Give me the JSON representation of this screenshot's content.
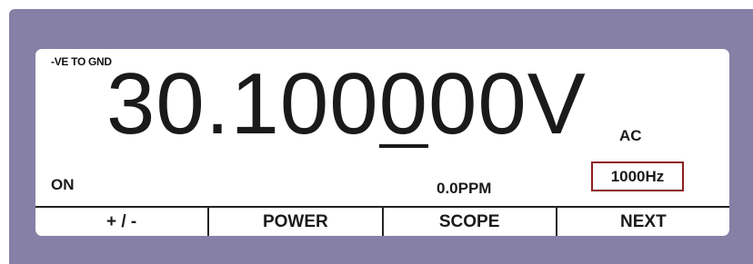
{
  "display": {
    "mode_label": "-VE TO GND",
    "reading_prefix": "30.100",
    "reading_cursor_digit": "0",
    "reading_suffix": "00V",
    "coupling": "AC",
    "output_state": "ON",
    "deviation": "0.0PPM",
    "frequency": "1000Hz"
  },
  "softkeys": [
    {
      "label": "+ / -"
    },
    {
      "label": "POWER"
    },
    {
      "label": "SCOPE"
    },
    {
      "label": "NEXT"
    }
  ],
  "colors": {
    "bezel": "#8680a6",
    "screen": "#ffffff",
    "frequency_highlight": "#8b2020"
  }
}
